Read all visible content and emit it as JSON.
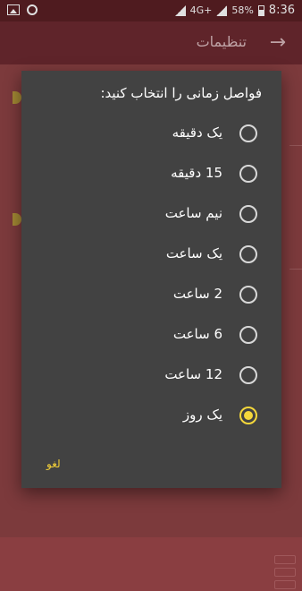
{
  "status_bar": {
    "time": "8:36",
    "battery": "58%",
    "network": "4G+",
    "icons": [
      "image-icon",
      "hotspot-icon",
      "signal-icon",
      "battery-icon"
    ]
  },
  "app_bar": {
    "title": "تنظیمات",
    "back_icon": "arrow-right-icon"
  },
  "dialog": {
    "title": "فواصل زمانی را انتخاب کنید:",
    "options": [
      {
        "label": "یک دقیقه",
        "selected": false
      },
      {
        "label": "15 دقیقه",
        "selected": false
      },
      {
        "label": "نیم ساعت",
        "selected": false
      },
      {
        "label": "یک ساعت",
        "selected": false
      },
      {
        "label": "2 ساعت",
        "selected": false
      },
      {
        "label": "6 ساعت",
        "selected": false
      },
      {
        "label": "12 ساعت",
        "selected": false
      },
      {
        "label": "یک روز",
        "selected": true
      }
    ],
    "cancel_label": "لغو"
  },
  "colors": {
    "accent": "#f4d73b",
    "dialog_bg": "#424242",
    "app_bar": "#6d2a30",
    "background": "#8e4245"
  }
}
